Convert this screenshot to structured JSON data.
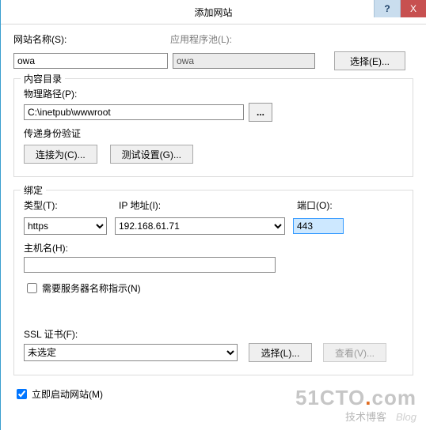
{
  "titlebar": {
    "title": "添加网站",
    "help": "?",
    "close": "X"
  },
  "site_name": {
    "label": "网站名称(S):",
    "value": "owa"
  },
  "app_pool": {
    "label": "应用程序池(L):",
    "value": "owa",
    "select_btn": "选择(E)..."
  },
  "content_dir": {
    "group_title": "内容目录",
    "phys_path_label": "物理路径(P):",
    "phys_path_value": "C:\\inetpub\\wwwroot",
    "browse_btn": "...",
    "passauth_label": "传递身份验证",
    "connect_as_btn": "连接为(C)...",
    "test_settings_btn": "测试设置(G)..."
  },
  "binding": {
    "group_title": "绑定",
    "type_label": "类型(T):",
    "type_value": "https",
    "ip_label": "IP 地址(I):",
    "ip_value": "192.168.61.71",
    "port_label": "端口(O):",
    "port_value": "443",
    "host_label": "主机名(H):",
    "host_value": "",
    "sni_label": "需要服务器名称指示(N)",
    "ssl_label": "SSL 证书(F):",
    "ssl_value": "未选定",
    "ssl_select_btn": "选择(L)...",
    "ssl_view_btn": "查看(V)..."
  },
  "start_now": {
    "label": "立即启动网站(M)"
  },
  "watermark": {
    "main_a": "51CTO",
    "main_b": ".",
    "main_c": "com",
    "sub_a": "技术博客",
    "sub_b": "Blog"
  }
}
